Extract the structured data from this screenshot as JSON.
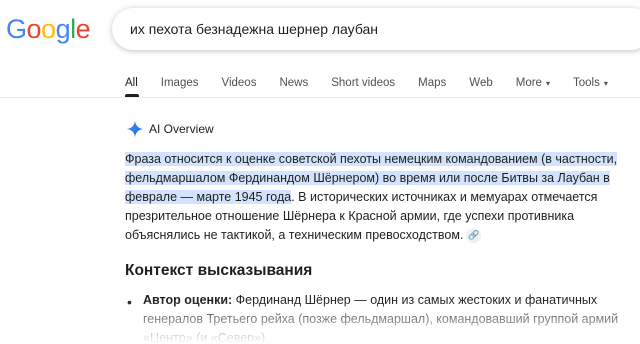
{
  "logo": {
    "text": "Google",
    "letters": [
      "G",
      "o",
      "o",
      "g",
      "l",
      "e"
    ],
    "colors": [
      "#4285f4",
      "#ea4335",
      "#fbbc05",
      "#4285f4",
      "#34a853",
      "#ea4335"
    ]
  },
  "search": {
    "query": "их пехота безнадежна шернер лаубан"
  },
  "tabs": [
    {
      "label": "All",
      "active": true
    },
    {
      "label": "Images"
    },
    {
      "label": "Videos"
    },
    {
      "label": "News"
    },
    {
      "label": "Short videos"
    },
    {
      "label": "Maps"
    },
    {
      "label": "Web"
    },
    {
      "label": "More",
      "dropdown": true
    },
    {
      "label": "Tools",
      "dropdown": true
    }
  ],
  "ai_overview": {
    "label": "AI Overview",
    "icon": "sparkle-icon",
    "paragraph_highlight": "Фраза относится к оценке советской пехоты немецким командованием (в частности, фельдмаршалом Фердинандом Шёрнером) во время или после Битвы за Лаубан в феврале — марте 1945 года",
    "paragraph_rest": ". В исторических источниках и мемуарах отмечается презрительное отношение Шёрнера к Красной армии, где успехи противника объяснялись не тактикой, а техническим превосходством.",
    "link_icon": "link-icon"
  },
  "section": {
    "title": "Контекст высказывания",
    "bullets": [
      {
        "bold": "Автор оценки:",
        "text": " Фердинанд Шёрнер — один из самых жестоких и фанатичных генералов Третьего рейха (позже фельдмаршал), командовавший группой армий «Центр» (и «Север»)."
      }
    ]
  }
}
